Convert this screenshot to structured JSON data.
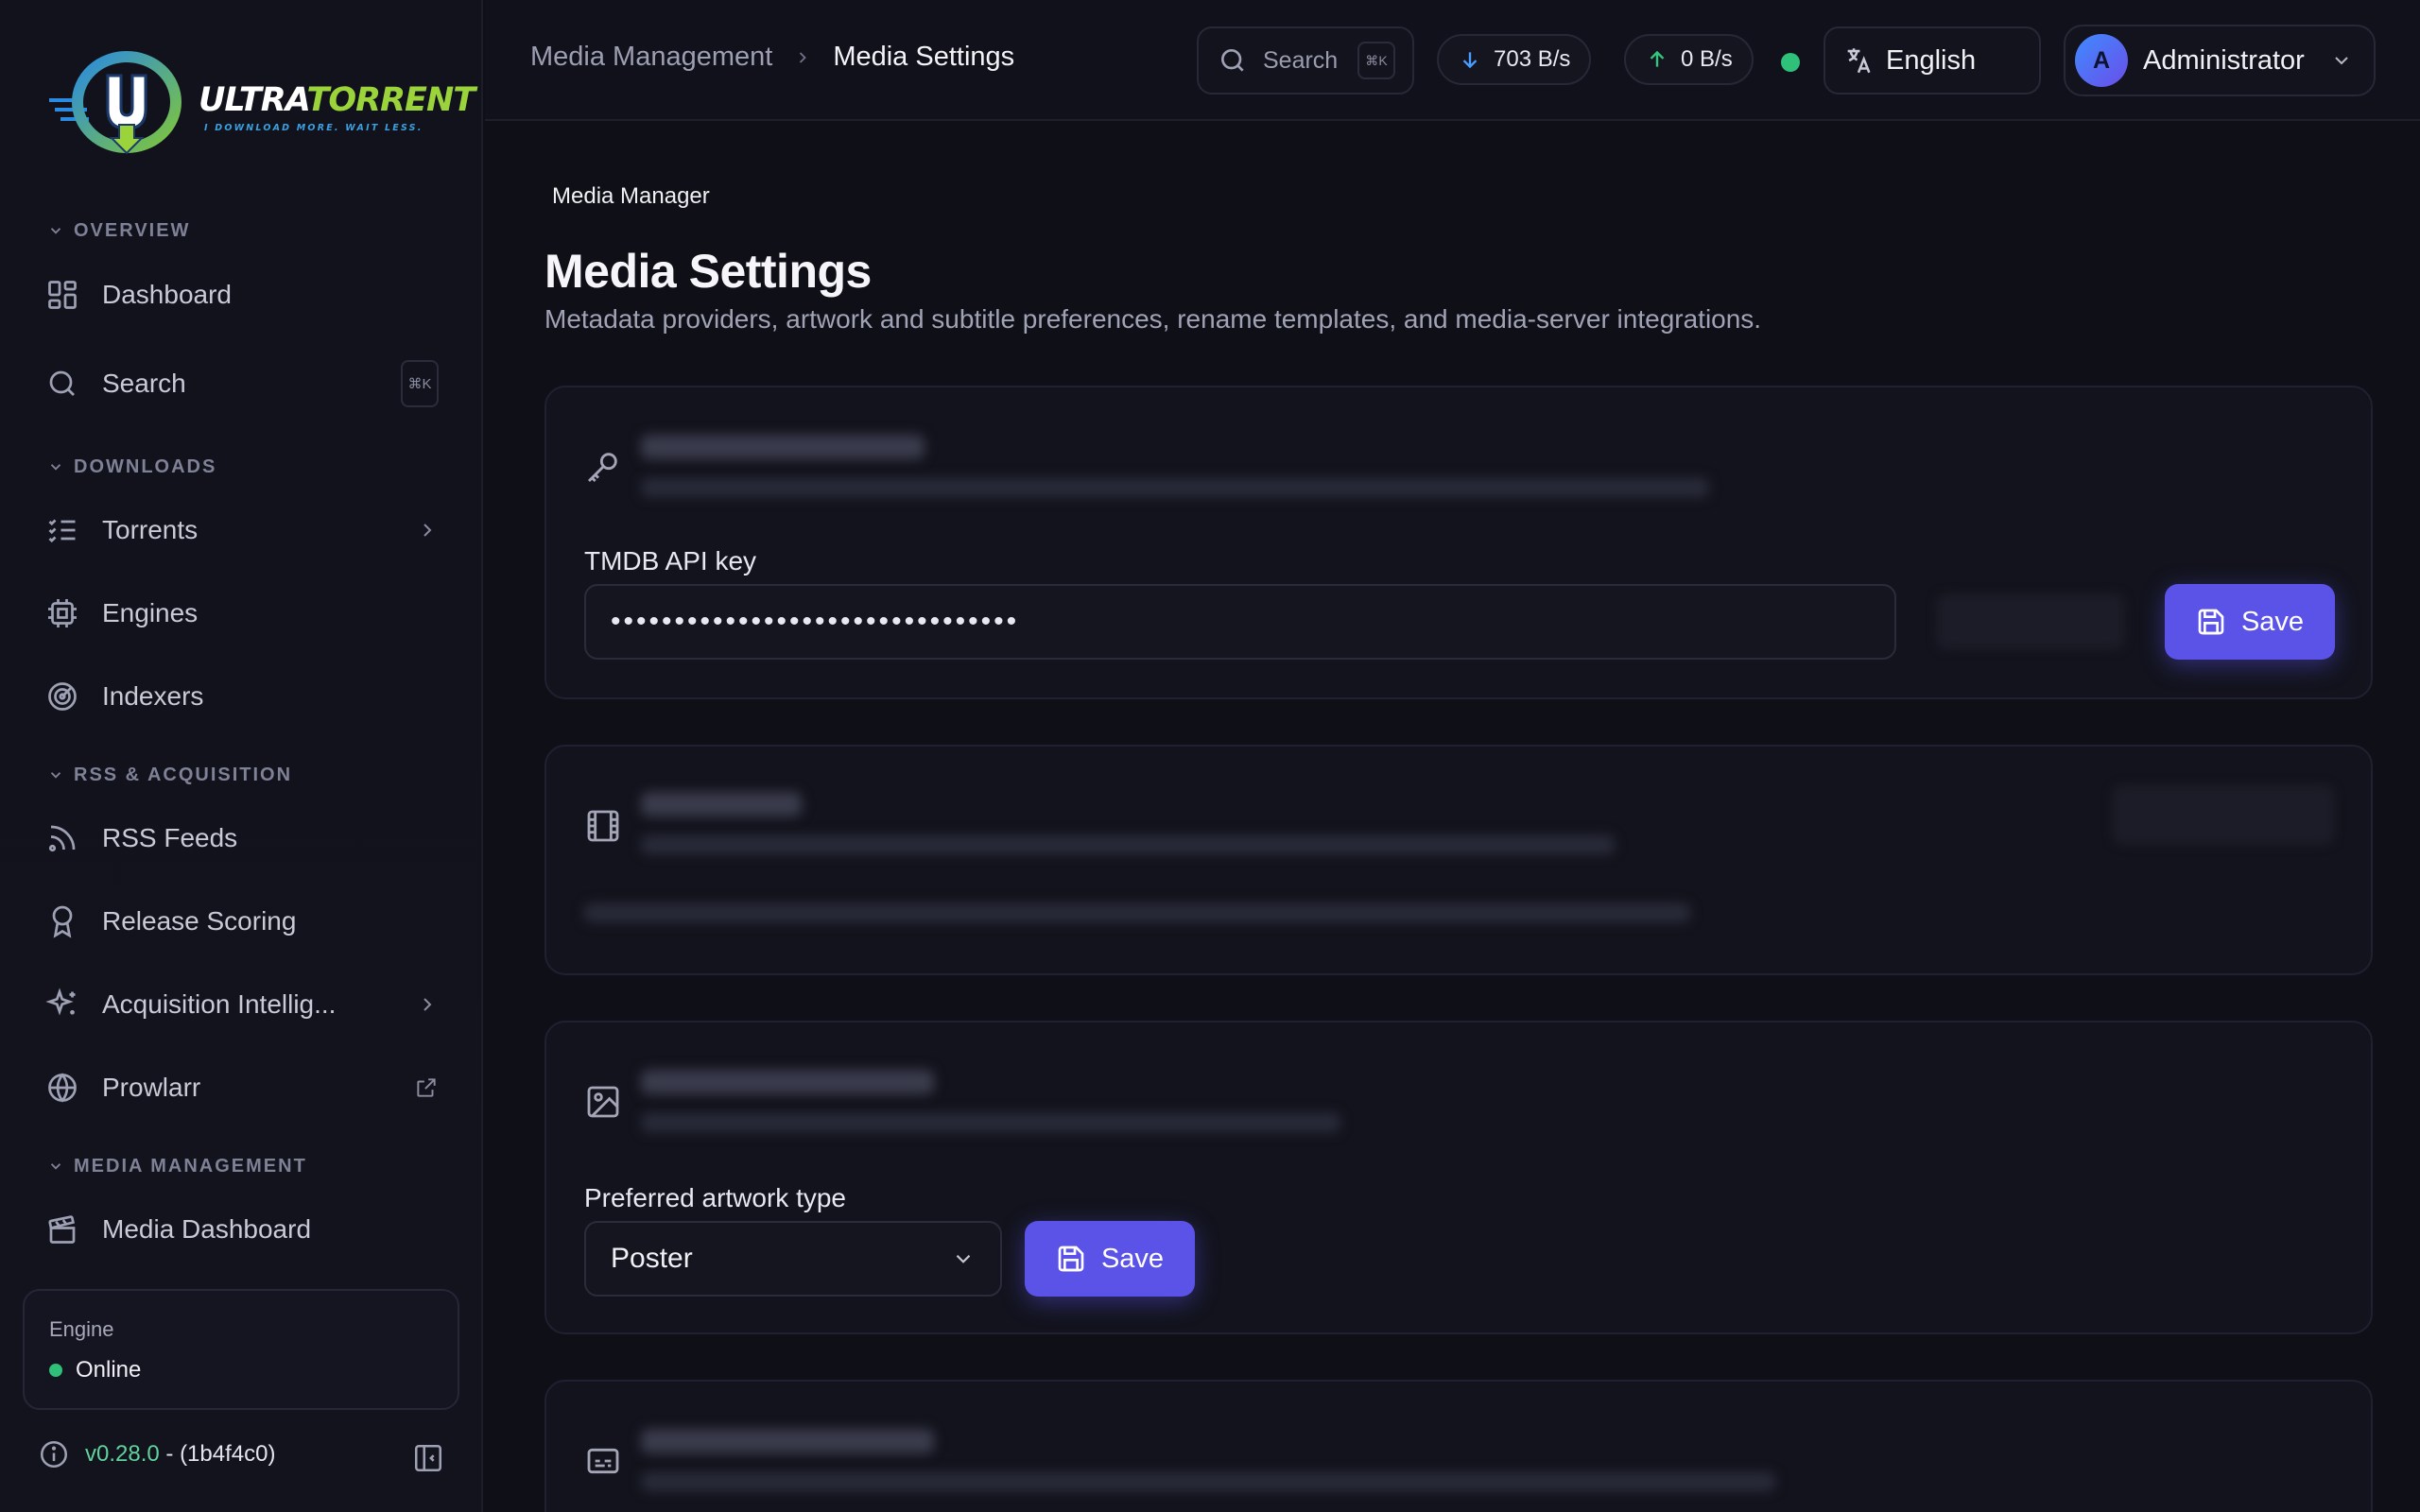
{
  "brand": {
    "name_part1": "ULTRA",
    "name_part2": "TORRENT",
    "tagline": "I DOWNLOAD MORE. WAIT LESS."
  },
  "sidebar": {
    "sections": {
      "overview": "OVERVIEW",
      "downloads": "DOWNLOADS",
      "rss": "RSS & ACQUISITION",
      "media": "MEDIA MANAGEMENT"
    },
    "items": {
      "dashboard": "Dashboard",
      "search": "Search",
      "search_shortcut": "⌘K",
      "torrents": "Torrents",
      "engines": "Engines",
      "indexers": "Indexers",
      "rss_feeds": "RSS Feeds",
      "release_scoring": "Release Scoring",
      "acquisition": "Acquisition Intellig...",
      "prowlarr": "Prowlarr",
      "media_dashboard": "Media Dashboard"
    },
    "engine": {
      "label": "Engine",
      "status": "Online"
    },
    "version": {
      "number": "v0.28.0",
      "build": "- (1b4f4c0)"
    }
  },
  "topbar": {
    "breadcrumb": [
      "Media Management",
      "Media Settings"
    ],
    "search_placeholder": "Search",
    "search_shortcut": "⌘K",
    "download_speed": "703 B/s",
    "upload_speed": "0 B/s",
    "language": "English",
    "user": {
      "initial": "A",
      "name": "Administrator"
    }
  },
  "page": {
    "eyebrow": "Media Manager",
    "title": "Media Settings",
    "subtitle": "Metadata providers, artwork and subtitle preferences, rename templates, and media-server integrations."
  },
  "cards": {
    "metadata": {
      "field_label": "TMDB API key",
      "field_value": "••••••••••••••••••••••••••••••••",
      "save_label": "Save"
    },
    "artwork": {
      "field_label": "Preferred artwork type",
      "selected": "Poster",
      "save_label": "Save"
    }
  },
  "colors": {
    "accent": "#5b52e8",
    "online": "#2fc07a",
    "download_arrow": "#4a9cff",
    "upload_arrow": "#34c77b"
  },
  "icons": {
    "logo": "ultratorrent-logo",
    "dashboard": "grid-icon",
    "search": "search-icon",
    "torrents": "list-check-icon",
    "engines": "cpu-icon",
    "indexers": "radar-icon",
    "rss": "rss-icon",
    "scoring": "award-icon",
    "acquisition": "sparkles-icon",
    "prowlarr": "globe-icon",
    "media_dashboard": "clapperboard-icon",
    "key": "key-icon",
    "film": "film-icon",
    "image": "image-icon",
    "subtitles": "subtitles-icon",
    "save": "save-icon"
  }
}
